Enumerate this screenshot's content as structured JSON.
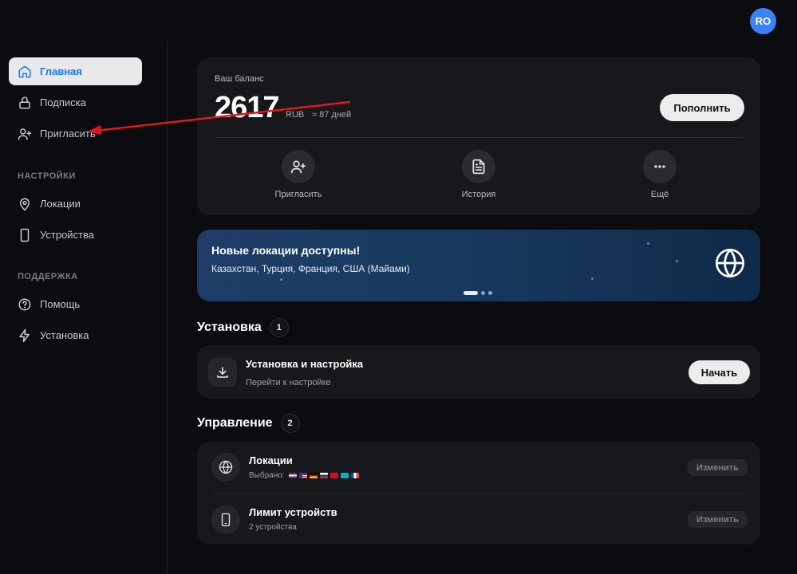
{
  "user": {
    "avatar_initials": "RO"
  },
  "sidebar": {
    "items": [
      {
        "label": "Главная",
        "icon": "home-icon",
        "active": true
      },
      {
        "label": "Подписка",
        "icon": "lock-icon"
      },
      {
        "label": "Пригласить",
        "icon": "user-plus-icon"
      }
    ],
    "settings_title": "НАСТРОЙКИ",
    "settings_items": [
      {
        "label": "Локации",
        "icon": "location-pin-icon"
      },
      {
        "label": "Устройства",
        "icon": "phone-icon"
      }
    ],
    "support_title": "ПОДДЕРЖКА",
    "support_items": [
      {
        "label": "Помощь",
        "icon": "help-icon"
      },
      {
        "label": "Установка",
        "icon": "lightning-icon"
      }
    ]
  },
  "balance": {
    "label": "Ваш баланс",
    "amount": "2617",
    "currency": "RUB",
    "days": "≈ 87 дней",
    "topup_label": "Пополнить",
    "actions": [
      {
        "label": "Пригласить",
        "icon": "user-plus-icon"
      },
      {
        "label": "История",
        "icon": "document-icon"
      },
      {
        "label": "Ещё",
        "icon": "more-icon"
      }
    ]
  },
  "banner": {
    "title": "Новые локации доступны!",
    "subtitle": "Казахстан, Турция, Франция, США (Майами)",
    "icon": "globe-icon",
    "slides": 3,
    "active_slide": 1
  },
  "install_section": {
    "title": "Установка",
    "count": "1",
    "item": {
      "title": "Установка и настройка",
      "subtitle": "Перейти к настройке",
      "icon": "download-icon",
      "button": "Начать"
    }
  },
  "manage_section": {
    "title": "Управление",
    "count": "2",
    "locations": {
      "title": "Локации",
      "subtitle": "Выбрано:",
      "button": "Изменить",
      "icon": "globe-icon",
      "flags": [
        "Netherlands",
        "USA",
        "Germany",
        "Russia",
        "Turkey",
        "Kazakhstan",
        "France"
      ]
    },
    "devices": {
      "title": "Лимит устройств",
      "subtitle": "2 устройства",
      "button": "Изменить",
      "icon": "phone-icon"
    }
  },
  "colors": {
    "accent": "#1677ff",
    "annotation": "#e5161c",
    "avatar": "#3b82f6"
  }
}
